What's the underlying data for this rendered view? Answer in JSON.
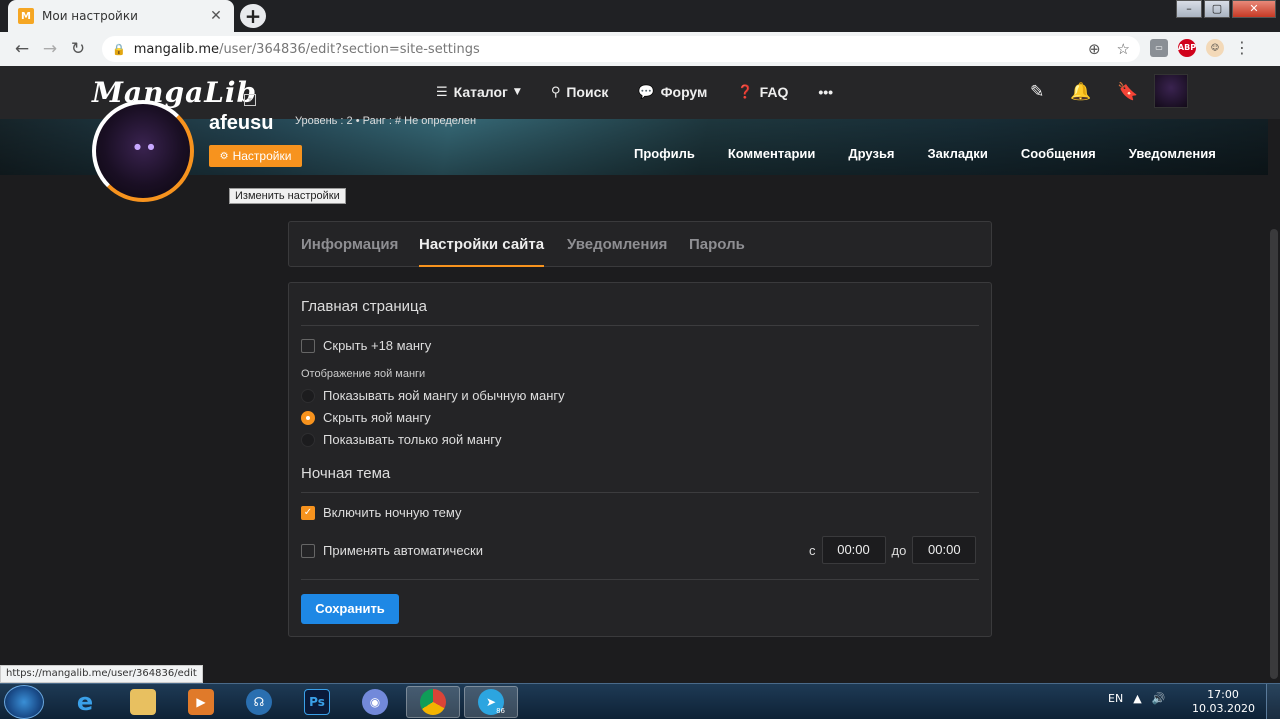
{
  "browser": {
    "tab_title": "Мои настройки",
    "tab_favicon": "mangalib-favicon",
    "new_tab_label": "+",
    "window_controls": [
      "minimize",
      "maximize",
      "close"
    ],
    "url_host": "mangalib.me",
    "url_path": "/user/364836/edit?section=site-settings",
    "status_url": "https://mangalib.me/user/364836/edit"
  },
  "site": {
    "logo": "MangaLib",
    "nav": [
      {
        "label": "Каталог",
        "icon": "list-icon",
        "dropdown": true
      },
      {
        "label": "Поиск",
        "icon": "search-icon"
      },
      {
        "label": "Форум",
        "icon": "chat-icon"
      },
      {
        "label": "FAQ",
        "icon": "help-icon"
      }
    ],
    "more_label": "•••"
  },
  "profile": {
    "username": "afeusu",
    "level_line": "Уровень : 2 • Ранг : # Не определен",
    "settings_button": "Настройки",
    "tooltip": "Изменить настройки",
    "tabs": [
      "Профиль",
      "Комментарии",
      "Друзья",
      "Закладки",
      "Сообщения",
      "Уведомления"
    ]
  },
  "settings": {
    "tabs": [
      {
        "label": "Информация",
        "active": false
      },
      {
        "label": "Настройки сайта",
        "active": true
      },
      {
        "label": "Уведомления",
        "active": false
      },
      {
        "label": "Пароль",
        "active": false
      }
    ],
    "main_page": {
      "title": "Главная страница",
      "hide_18": {
        "label": "Скрыть +18 мангу",
        "checked": false
      },
      "yaoi_label": "Отображение яой манги",
      "yaoi_options": [
        {
          "label": "Показывать яой мангу и обычную мангу",
          "checked": false
        },
        {
          "label": "Скрыть яой мангу",
          "checked": true
        },
        {
          "label": "Показывать только яой мангу",
          "checked": false
        }
      ]
    },
    "night_theme": {
      "title": "Ночная тема",
      "enable": {
        "label": "Включить ночную тему",
        "checked": true
      },
      "auto": {
        "label": "Применять автоматически",
        "checked": false
      },
      "from_label": "с",
      "from_value": "00:00",
      "to_label": "до",
      "to_value": "00:00"
    },
    "save_button": "Сохранить"
  },
  "taskbar": {
    "language": "EN",
    "time": "17:00",
    "date": "10.03.2020",
    "telegram_badge": "86"
  },
  "colors": {
    "accent": "#f7931e",
    "primary_button": "#1e88e5",
    "background": "#1c1c1e",
    "card": "#242426"
  }
}
